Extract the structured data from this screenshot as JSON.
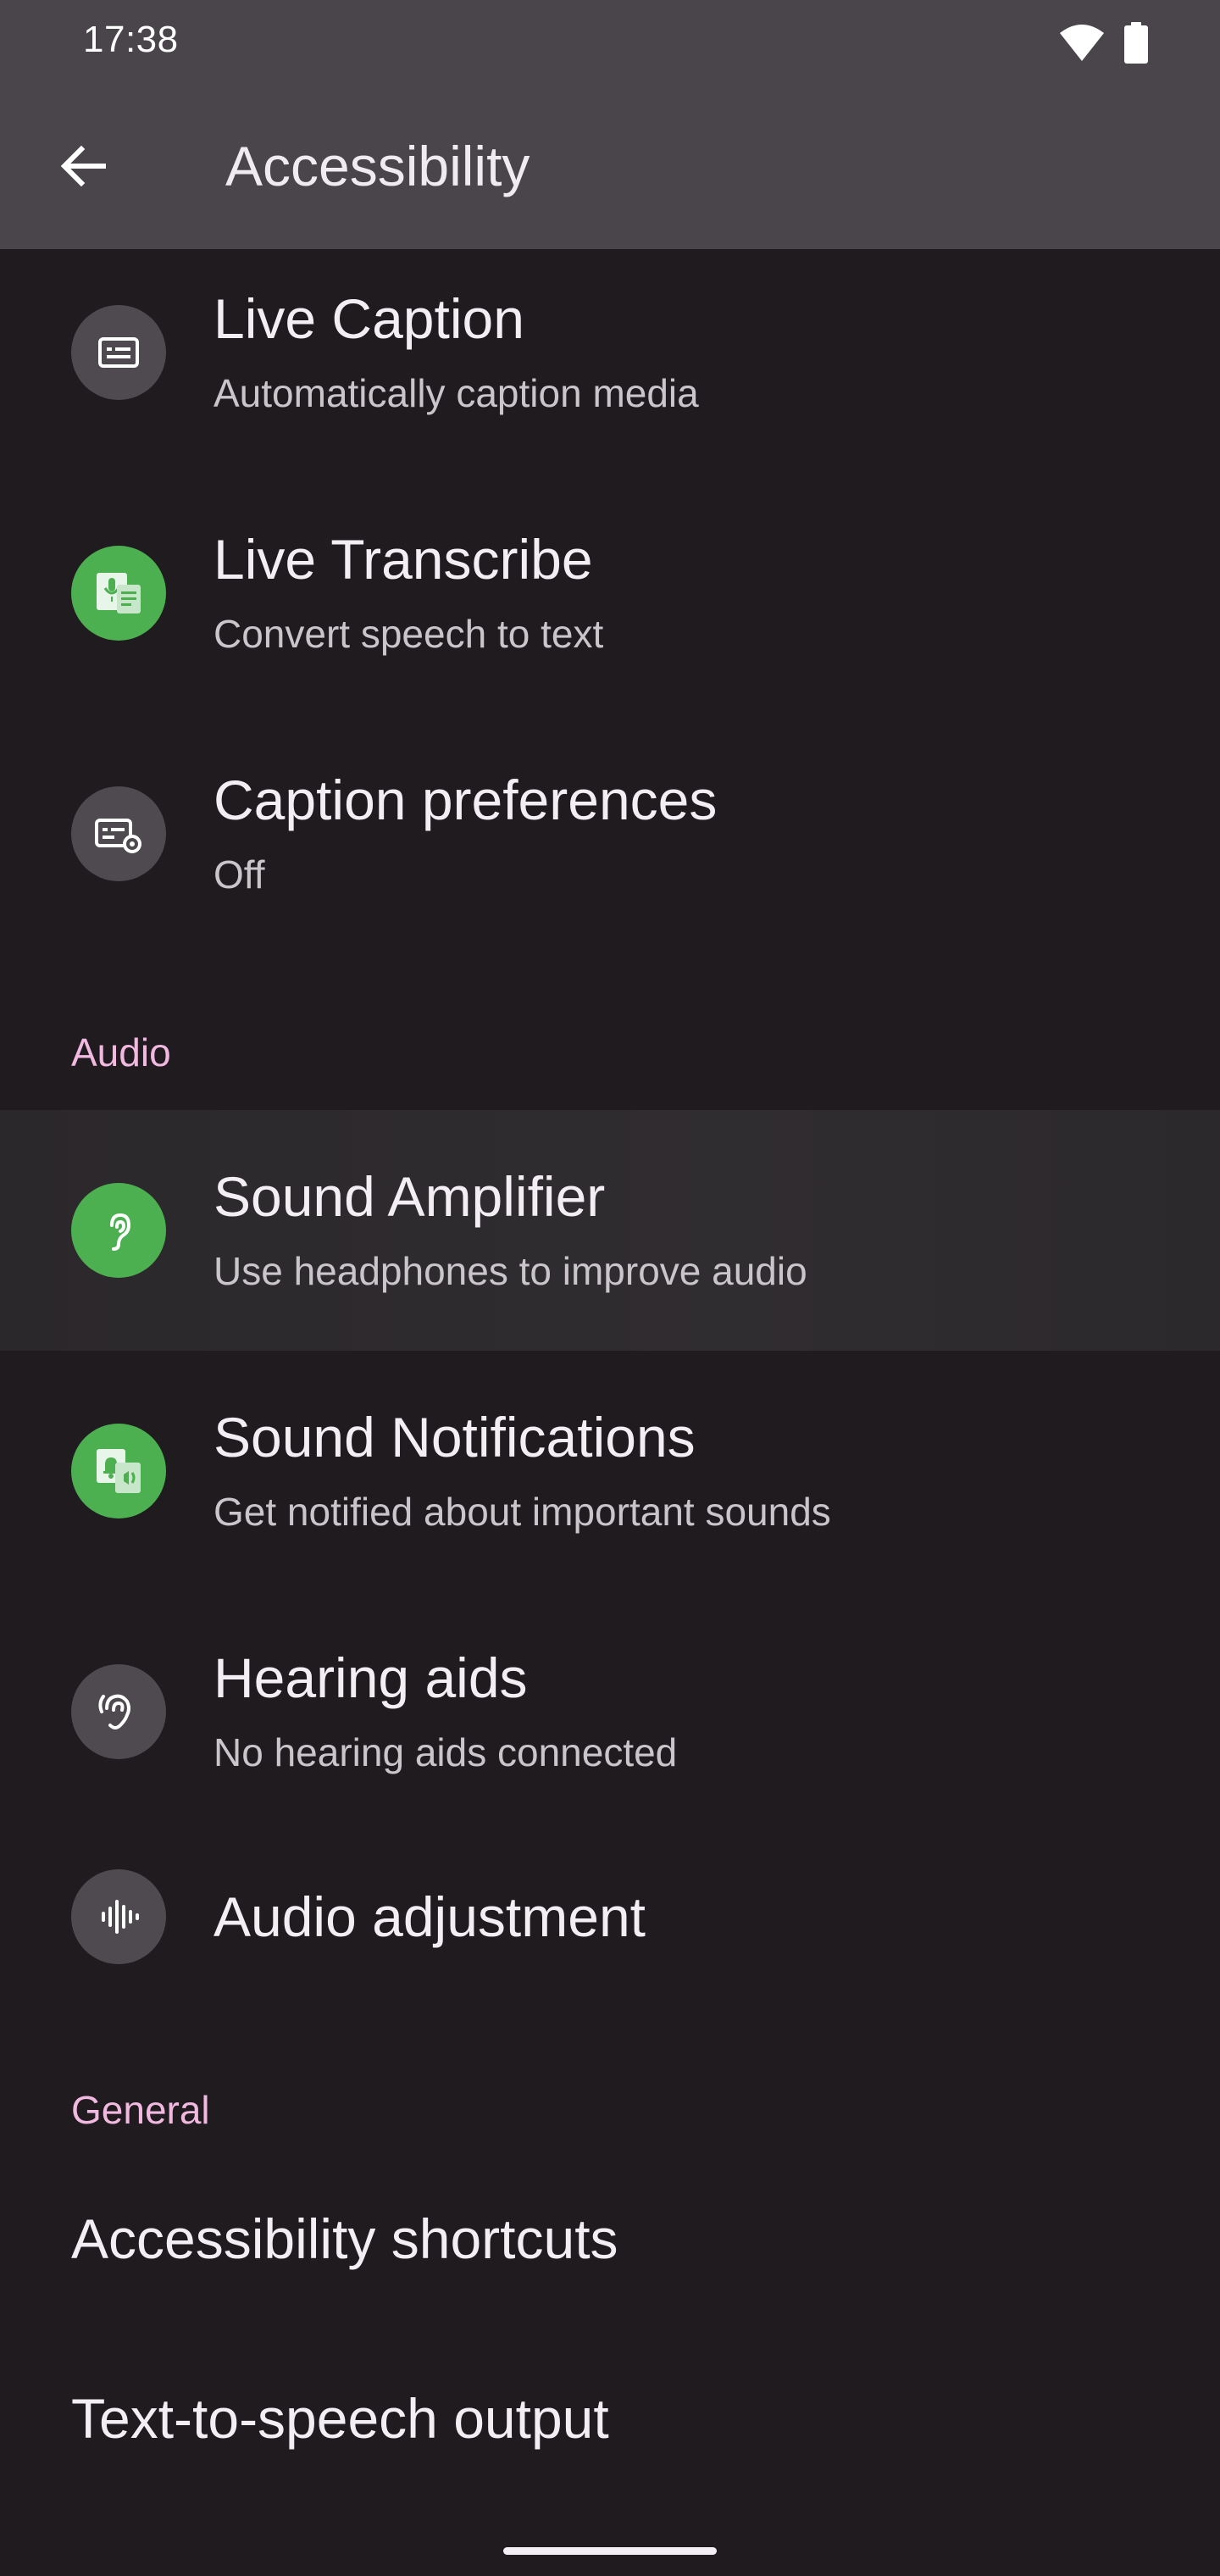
{
  "status_bar": {
    "time": "17:38",
    "icons": [
      "wifi-icon",
      "battery-icon"
    ]
  },
  "app_bar": {
    "title": "Accessibility",
    "back_icon": "arrow-back-icon"
  },
  "captions_items": [
    {
      "title": "Live Caption",
      "subtitle": "Automatically caption media",
      "icon": "live-caption-icon",
      "icon_bg": "#4e4a4f"
    },
    {
      "title": "Live Transcribe",
      "subtitle": "Convert speech to text",
      "icon": "live-transcribe-icon",
      "icon_bg": "#4caf50"
    },
    {
      "title": "Caption preferences",
      "subtitle": "Off",
      "icon": "caption-preferences-icon",
      "icon_bg": "#4e4a4f"
    }
  ],
  "audio_section": {
    "header": "Audio",
    "items": [
      {
        "title": "Sound Amplifier",
        "subtitle": "Use headphones to improve audio",
        "icon": "ear-icon",
        "icon_bg": "#4caf50"
      },
      {
        "title": "Sound Notifications",
        "subtitle": "Get notified about important sounds",
        "icon": "sound-notifications-icon",
        "icon_bg": "#4caf50"
      },
      {
        "title": "Hearing aids",
        "subtitle": "No hearing aids connected",
        "icon": "hearing-aid-icon",
        "icon_bg": "#4e4a4f"
      },
      {
        "title": "Audio adjustment",
        "subtitle": "",
        "icon": "audio-waveform-icon",
        "icon_bg": "#4e4a4f"
      }
    ]
  },
  "general_section": {
    "header": "General",
    "items": [
      {
        "title": "Accessibility shortcuts"
      },
      {
        "title": "Text-to-speech output"
      }
    ]
  },
  "colors": {
    "background": "#1f1b1f",
    "app_bar": "#49454a",
    "section_header": "#f1b8e0",
    "green_icon": "#4caf50",
    "grey_icon": "#4e4a4f"
  }
}
